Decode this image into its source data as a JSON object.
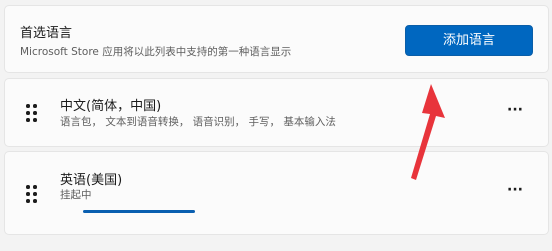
{
  "header": {
    "title": "首选语言",
    "subtitle": "Microsoft Store 应用将以此列表中支持的第一种语言显示",
    "add_button_label": "添加语言"
  },
  "languages": [
    {
      "name": "中文(简体，中国)",
      "detail": "语言包， 文本到语音转换， 语音识别， 手写， 基本输入法",
      "more_label": "···"
    },
    {
      "name": "英语(美国)",
      "detail": "挂起中",
      "more_label": "···",
      "progress": 1.0
    }
  ],
  "colors": {
    "accent": "#0067c0",
    "annotation_arrow": "#e8343b",
    "progress": "#0a5fb0"
  }
}
